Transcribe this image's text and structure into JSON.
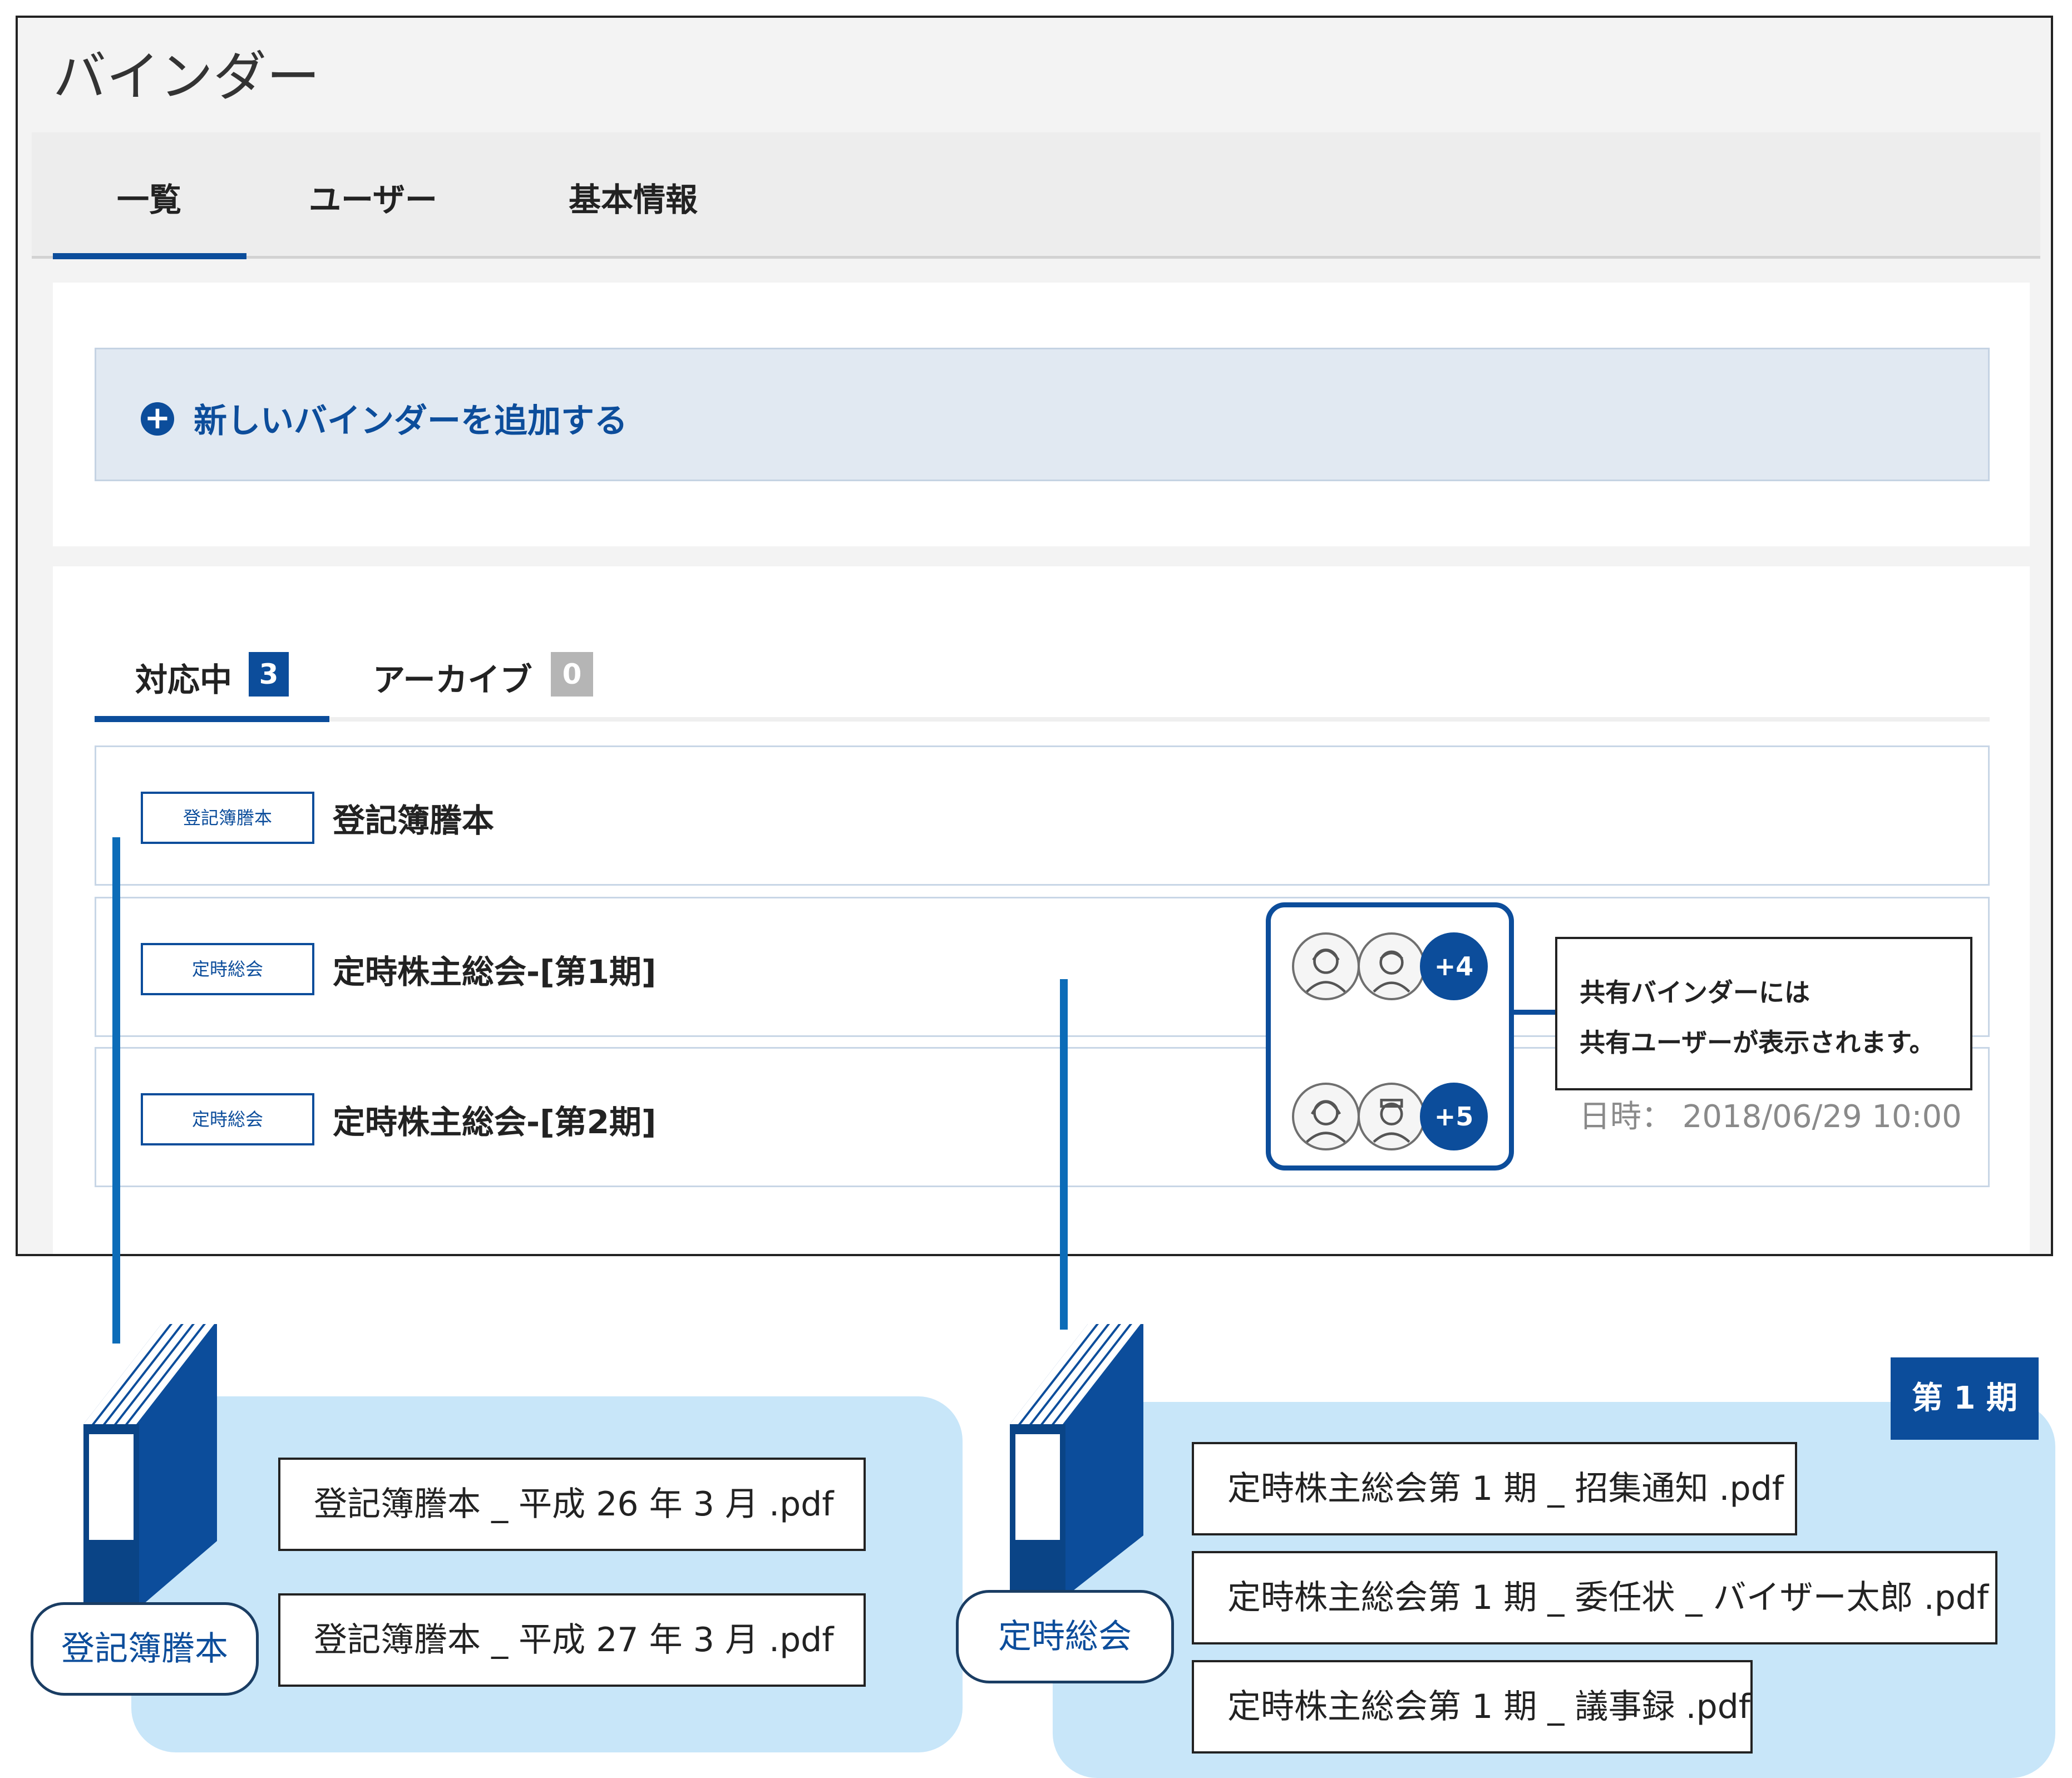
{
  "header": {
    "title": "バインダー"
  },
  "nav": {
    "tabs": [
      {
        "label": "一覧"
      },
      {
        "label": "ユーザー"
      },
      {
        "label": "基本情報"
      }
    ]
  },
  "actions": {
    "add_binder": "新しいバインダーを追加する"
  },
  "subtabs": {
    "active": {
      "label": "対応中",
      "count": "3"
    },
    "archive": {
      "label": "アーカイブ",
      "count": "0"
    }
  },
  "binders": [
    {
      "tag": "登記簿謄本",
      "title": "登記簿謄本"
    },
    {
      "tag": "定時総会",
      "title": "定時株主総会-[第1期]",
      "shared_more": "+4"
    },
    {
      "tag": "定時総会",
      "title": "定時株主総会-[第2期]",
      "shared_more": "+5"
    }
  ],
  "note": {
    "line1": "共有バインダーには",
    "line2": "共有ユーザーが表示されます。"
  },
  "datetime": "日時： 2018/06/29 10:00",
  "diagram": {
    "left": {
      "label": "登記簿謄本",
      "files": [
        "登記簿謄本 _ 平成 26 年 3 月 .pdf",
        "登記簿謄本 _ 平成 27 年 3 月 .pdf"
      ]
    },
    "right": {
      "label": "定時総会",
      "period": "第 1 期",
      "files": [
        "定時株主総会第 1 期 _ 招集通知 .pdf",
        "定時株主総会第 1 期 _ 委任状 _ バイザー太郎 .pdf",
        "定時株主総会第 1 期 _ 議事録 .pdf"
      ]
    }
  },
  "colors": {
    "accent": "#0c4d9b",
    "light_panel": "#e1e9f2",
    "cloud": "#c8e6f9"
  }
}
